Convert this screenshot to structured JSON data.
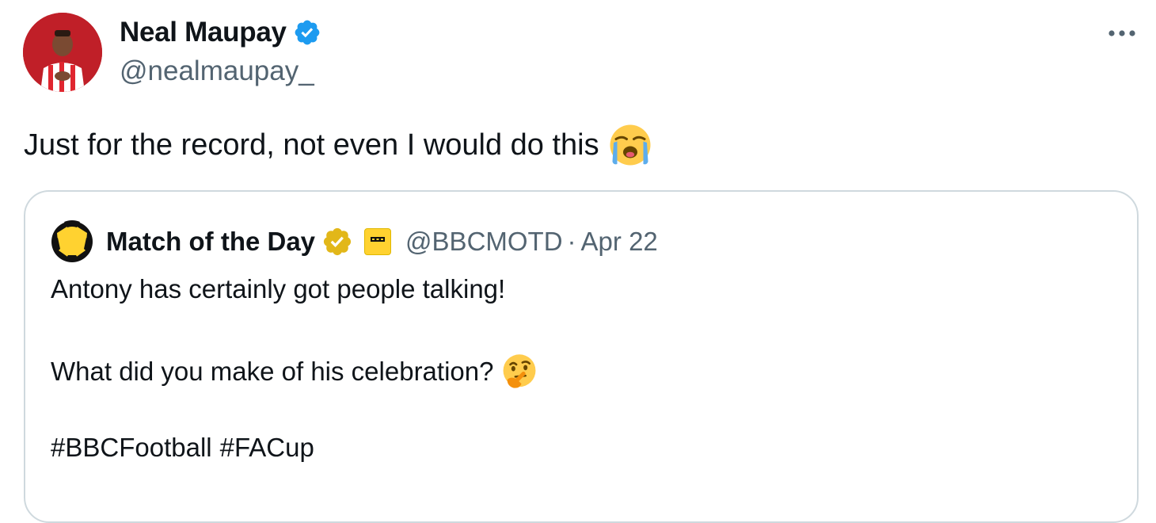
{
  "author": {
    "name": "Neal Maupay",
    "handle": "@nealmaupay_",
    "verified": true,
    "verified_color": "#1d9bf0",
    "avatar_icon": "profile-photo"
  },
  "tweet": {
    "text": "Just for the record, not even I would do this",
    "emoji": "loudly-crying-face"
  },
  "more_icon": "ellipsis-icon",
  "quote": {
    "name": "Match of the Day",
    "handle": "@BBCMOTD",
    "separator": "·",
    "date": "Apr 22",
    "verified": true,
    "verified_color": "#e2b719",
    "affiliate_icon": "bbc-affiliate-badge",
    "line1": "Antony has certainly got people talking!",
    "line2": "What did you make of his celebration?",
    "line2_emoji": "thinking-face",
    "hashtags": [
      "#BBCFootball",
      "#FACup"
    ]
  },
  "colors": {
    "text": "#0f1419",
    "muted": "#536471",
    "border": "#cfd9de",
    "brand_blue": "#1d9bf0",
    "motd_yellow": "#ffd230"
  }
}
